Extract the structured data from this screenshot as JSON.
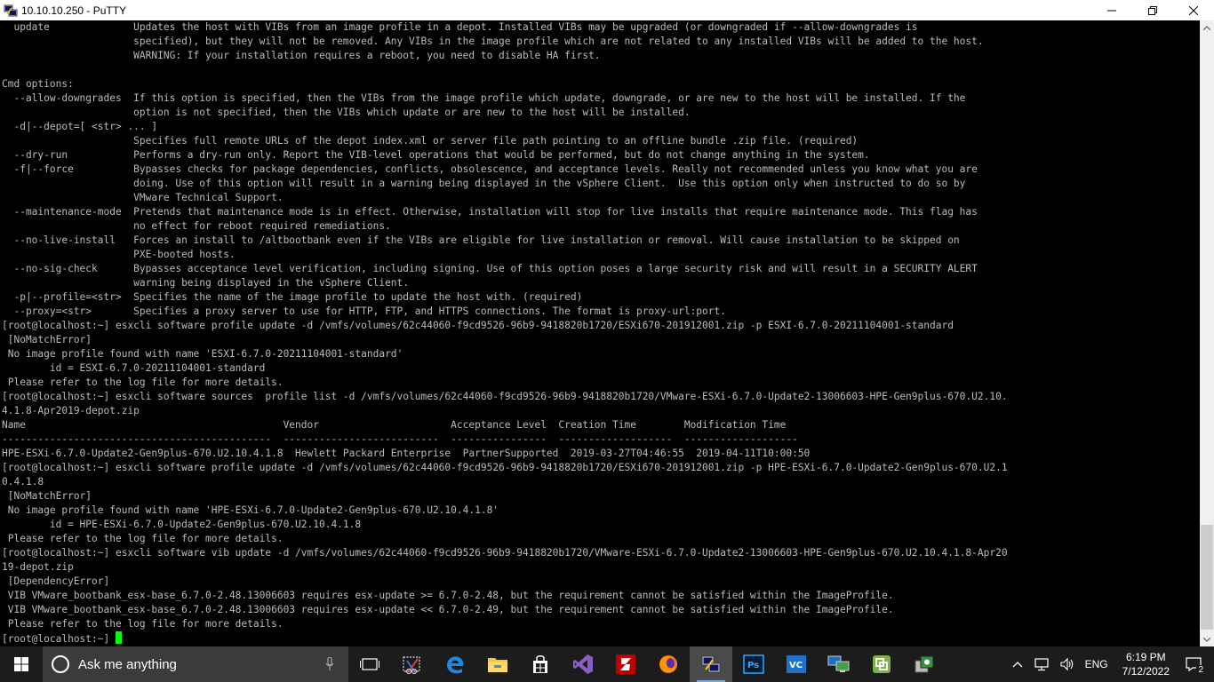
{
  "window": {
    "title": "10.10.10.250 - PuTTY",
    "icon": "putty-icon",
    "controls": [
      "minimize-icon",
      "restore-icon",
      "close-icon"
    ]
  },
  "terminal": {
    "lines": [
      "  update              Updates the host with VIBs from an image profile in a depot. Installed VIBs may be upgraded (or downgraded if --allow-downgrades is",
      "                      specified), but they will not be removed. Any VIBs in the image profile which are not related to any installed VIBs will be added to the host.",
      "                      WARNING: If your installation requires a reboot, you need to disable HA first.",
      "",
      "Cmd options:",
      "  --allow-downgrades  If this option is specified, then the VIBs from the image profile which update, downgrade, or are new to the host will be installed. If the",
      "                      option is not specified, then the VIBs which update or are new to the host will be installed.",
      "  -d|--depot=[ <str> ... ]",
      "                      Specifies full remote URLs of the depot index.xml or server file path pointing to an offline bundle .zip file. (required)",
      "  --dry-run           Performs a dry-run only. Report the VIB-level operations that would be performed, but do not change anything in the system.",
      "  -f|--force          Bypasses checks for package dependencies, conflicts, obsolescence, and acceptance levels. Really not recommended unless you know what you are",
      "                      doing. Use of this option will result in a warning being displayed in the vSphere Client.  Use this option only when instructed to do so by",
      "                      VMware Technical Support.",
      "  --maintenance-mode  Pretends that maintenance mode is in effect. Otherwise, installation will stop for live installs that require maintenance mode. This flag has",
      "                      no effect for reboot required remediations.",
      "  --no-live-install   Forces an install to /altbootbank even if the VIBs are eligible for live installation or removal. Will cause installation to be skipped on",
      "                      PXE-booted hosts.",
      "  --no-sig-check      Bypasses acceptance level verification, including signing. Use of this option poses a large security risk and will result in a SECURITY ALERT",
      "                      warning being displayed in the vSphere Client.",
      "  -p|--profile=<str>  Specifies the name of the image profile to update the host with. (required)",
      "  --proxy=<str>       Specifies a proxy server to use for HTTP, FTP, and HTTPS connections. The format is proxy-url:port.",
      "[root@localhost:~] esxcli software profile update -d /vmfs/volumes/62c44060-f9cd9526-96b9-9418820b1720/ESXi670-201912001.zip -p ESXI-6.7.0-20211104001-standard",
      " [NoMatchError]",
      " No image profile found with name 'ESXI-6.7.0-20211104001-standard'",
      "        id = ESXI-6.7.0-20211104001-standard",
      " Please refer to the log file for more details.",
      "[root@localhost:~] esxcli software sources  profile list -d /vmfs/volumes/62c44060-f9cd9526-96b9-9418820b1720/VMware-ESXi-6.7.0-Update2-13006603-HPE-Gen9plus-670.U2.10.",
      "4.1.8-Apr2019-depot.zip",
      "Name                                           Vendor                      Acceptance Level  Creation Time        Modification Time",
      "---------------------------------------------  --------------------------  ----------------  -------------------  -------------------",
      "HPE-ESXi-6.7.0-Update2-Gen9plus-670.U2.10.4.1.8  Hewlett Packard Enterprise  PartnerSupported  2019-03-27T04:46:55  2019-04-11T10:00:50",
      "[root@localhost:~] esxcli software profile update -d /vmfs/volumes/62c44060-f9cd9526-96b9-9418820b1720/ESXi670-201912001.zip -p HPE-ESXi-6.7.0-Update2-Gen9plus-670.U2.1",
      "0.4.1.8",
      " [NoMatchError]",
      " No image profile found with name 'HPE-ESXi-6.7.0-Update2-Gen9plus-670.U2.10.4.1.8'",
      "        id = HPE-ESXi-6.7.0-Update2-Gen9plus-670.U2.10.4.1.8",
      " Please refer to the log file for more details.",
      "[root@localhost:~] esxcli software vib update -d /vmfs/volumes/62c44060-f9cd9526-96b9-9418820b1720/VMware-ESXi-6.7.0-Update2-13006603-HPE-Gen9plus-670.U2.10.4.1.8-Apr20",
      "19-depot.zip",
      " [DependencyError]",
      " VIB VMware_bootbank_esx-base_6.7.0-2.48.13006603 requires esx-update >= 6.7.0-2.48, but the requirement cannot be satisfied within the ImageProfile.",
      " VIB VMware_bootbank_esx-base_6.7.0-2.48.13006603 requires esx-update << 6.7.0-2.49, but the requirement cannot be satisfied within the ImageProfile.",
      " Please refer to the log file for more details."
    ],
    "prompt": "[root@localhost:~] ",
    "cursor_color": "#00ff00",
    "text_color": "#bbbbbb",
    "background": "#000000"
  },
  "taskbar": {
    "search_placeholder": "Ask me anything",
    "apps": [
      {
        "name": "task-view-icon",
        "running": false
      },
      {
        "name": "snipping-tool-icon",
        "running": false
      },
      {
        "name": "edge-icon",
        "running": false
      },
      {
        "name": "file-explorer-icon",
        "running": false
      },
      {
        "name": "store-icon",
        "running": false
      },
      {
        "name": "visual-studio-icon",
        "running": false
      },
      {
        "name": "filezilla-icon",
        "running": false
      },
      {
        "name": "firefox-icon",
        "running": false
      },
      {
        "name": "putty-icon",
        "running": true
      },
      {
        "name": "photoshop-icon",
        "running": false
      },
      {
        "name": "vs-code-icon",
        "running": false
      },
      {
        "name": "remote-desktop-icon",
        "running": false
      },
      {
        "name": "vsphere-client-icon",
        "running": false
      },
      {
        "name": "manager-icon",
        "running": false
      }
    ],
    "language": "ENG",
    "time": "6:19 PM",
    "date": "7/12/2022",
    "notifications_count": "2"
  }
}
